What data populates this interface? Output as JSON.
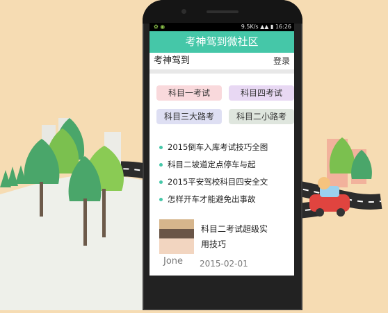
{
  "status_bar": {
    "speed": "9.5K/s",
    "time": "16:26",
    "left_icons": [
      "wechat-icon",
      "cat-icon"
    ]
  },
  "header": {
    "title": "考神驾到微社区"
  },
  "brand_bar": {
    "brand": "考神驾到",
    "login": "登录"
  },
  "chips": [
    {
      "label": "科目一考试",
      "color": "#f9d9dc"
    },
    {
      "label": "科目四考试",
      "color": "#e8d8f3"
    },
    {
      "label": "科目三大路考",
      "color": "#dedff3"
    },
    {
      "label": "科目二小路考",
      "color": "#dfe6de"
    }
  ],
  "news": [
    "2015倒车入库考试技巧全图",
    "科目二坡道定点停车与起",
    "2015平安驾校科目四安全文",
    "怎样开车才能避免出事故"
  ],
  "post": {
    "title_line1": "科目二考试超级实",
    "title_line2": "用技巧",
    "author": "Jone",
    "date": "2015-02-01"
  },
  "colors": {
    "accent": "#45c7a8",
    "background": "#f6dcb3"
  }
}
